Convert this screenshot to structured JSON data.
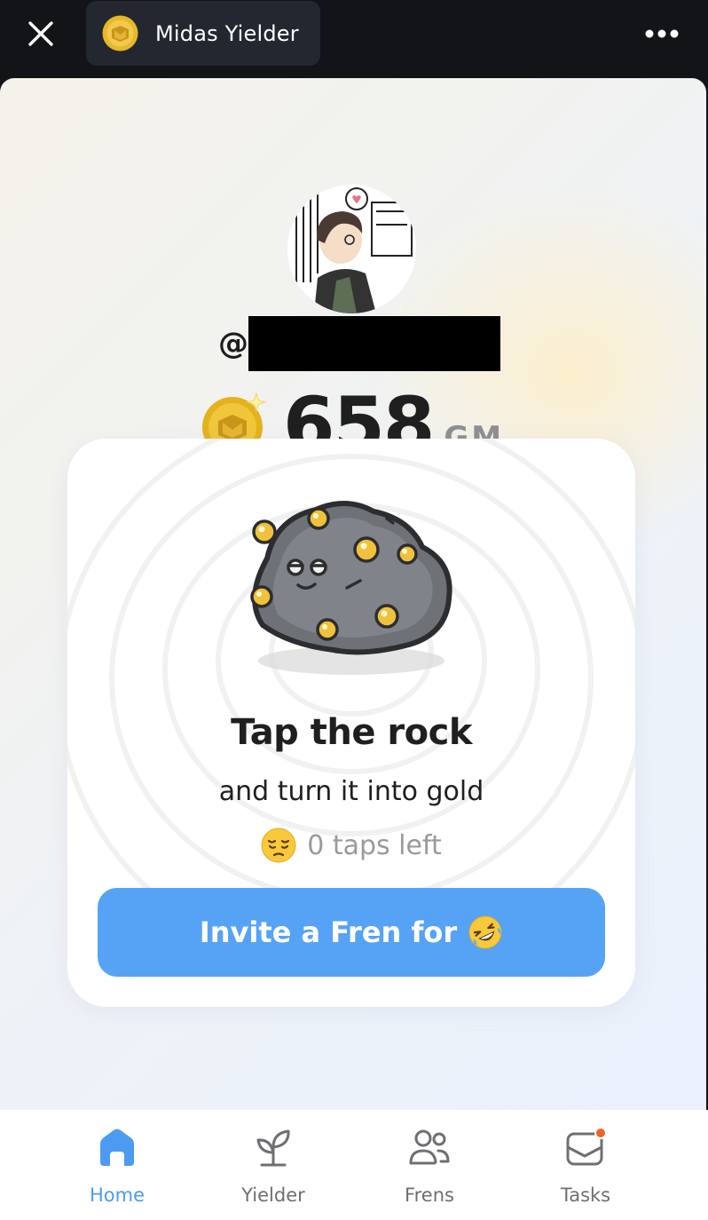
{
  "header": {
    "app_title": "Midas Yielder",
    "close_icon": "close-icon",
    "more_icon": "more-horizontal-icon"
  },
  "profile": {
    "handle_prefix": "@",
    "balance": "658",
    "balance_unit": "GM"
  },
  "card": {
    "title": "Tap the rock",
    "subtitle": "and turn it into gold",
    "taps_left_text": "0 taps left",
    "taps_emoji": "pensive-face",
    "invite_button_label": "Invite a Fren for",
    "invite_emoji": "rolling-on-floor-laughing"
  },
  "nav": {
    "items": [
      {
        "label": "Home",
        "icon": "home-icon",
        "active": true
      },
      {
        "label": "Yielder",
        "icon": "sprout-icon",
        "active": false
      },
      {
        "label": "Frens",
        "icon": "users-icon",
        "active": false
      },
      {
        "label": "Tasks",
        "icon": "mail-notification-icon",
        "active": false,
        "badge": true
      }
    ]
  },
  "colors": {
    "accent": "#56a3f5",
    "active_nav": "#4d9bf0",
    "gold": "#e8b923",
    "badge": "#f0642a"
  }
}
